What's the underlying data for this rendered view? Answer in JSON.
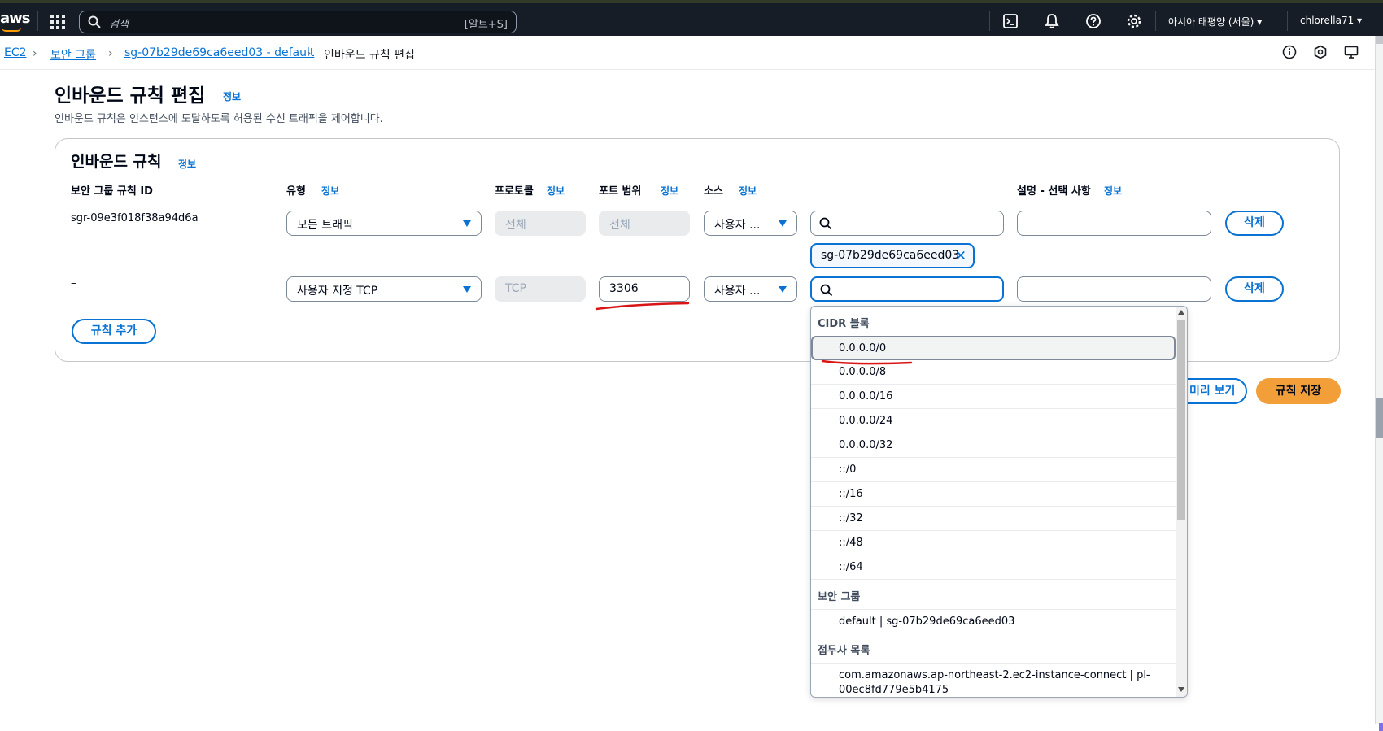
{
  "nav": {
    "logo": "aws",
    "search_placeholder": "검색",
    "search_shortcut": "[알트+S]",
    "region": "아시아 태평양 (서울) ▾",
    "user": "chlorella71 ▾",
    "icons": [
      "apps-grid-icon",
      "cloudshell-icon",
      "bell-icon",
      "help-icon",
      "gear-icon"
    ]
  },
  "breadcrumb": {
    "items": [
      "EC2",
      "보안 그룹",
      "sg-07b29de69ca6eed03 - default"
    ],
    "current": "인바운드 규칙 편집"
  },
  "page": {
    "title": "인바운드 규칙 편집",
    "info": "정보",
    "description": "인바운드 규칙은 인스턴스에 도달하도록 허용된 수신 트래픽을 제어합니다."
  },
  "panel": {
    "title": "인바운드 규칙",
    "info": "정보",
    "columns": {
      "rule_id": "보안 그룹 규칙 ID",
      "type": "유형",
      "protocol": "프로토콜",
      "port_range": "포트 범위",
      "source": "소스",
      "description": "설명 - 선택 사항"
    },
    "rows": [
      {
        "rule_id": "sgr-09e3f018f38a94d6a",
        "type": "모든 트래픽",
        "protocol": "전체",
        "port_range": "전체",
        "source_type": "사용자 ...",
        "source_search": "",
        "source_token": "sg-07b29de69ca6eed03",
        "description": "",
        "delete": "삭제"
      },
      {
        "rule_id": "–",
        "type": "사용자 지정 TCP",
        "protocol": "TCP",
        "port_range": "3306",
        "source_type": "사용자 ...",
        "source_search": "",
        "description": "",
        "delete": "삭제"
      }
    ],
    "add_rule": "규칙 추가"
  },
  "actions": {
    "preview": "미리 보기",
    "save": "규칙 저장"
  },
  "dropdown": {
    "groups": [
      {
        "label": "CIDR 블록",
        "items": [
          "0.0.0.0/0",
          "0.0.0.0/8",
          "0.0.0.0/16",
          "0.0.0.0/24",
          "0.0.0.0/32",
          "::/0",
          "::/16",
          "::/32",
          "::/48",
          "::/64"
        ]
      },
      {
        "label": "보안 그룹",
        "items": [
          "default | sg-07b29de69ca6eed03"
        ]
      },
      {
        "label": "접두사 목록",
        "items": [
          "com.amazonaws.ap-northeast-2.ec2-instance-connect | pl-00ec8fd779e5b4175"
        ]
      }
    ],
    "highlighted": "0.0.0.0/0"
  },
  "colors": {
    "accent": "#0972d3",
    "save_button": "#f29f3a",
    "nav_bg": "#161d26",
    "annotation": "#d91515"
  }
}
